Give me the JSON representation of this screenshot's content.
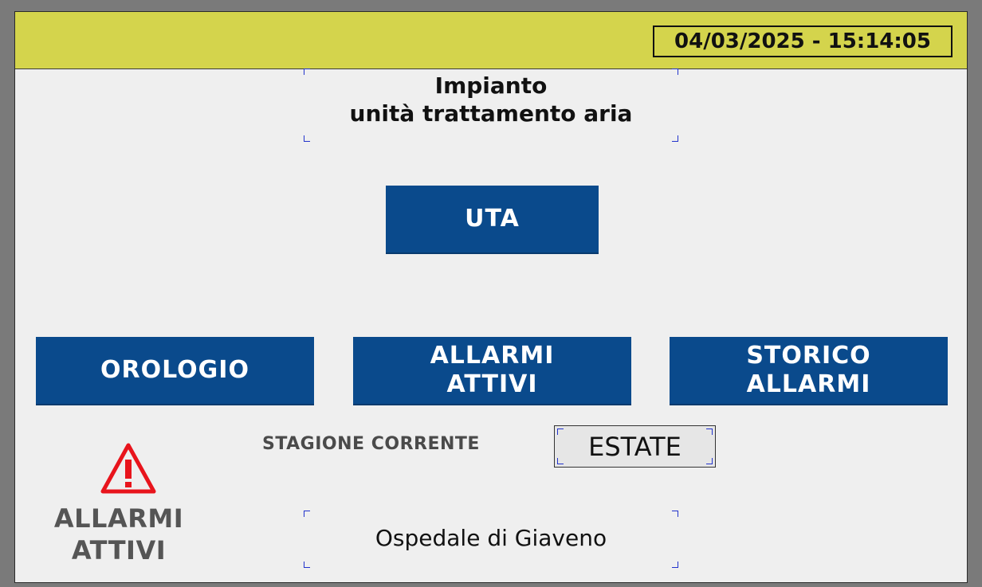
{
  "header": {
    "datetime": "04/03/2025 - 15:14:05",
    "background_color": "#d4d44c"
  },
  "title": {
    "line1": "Impianto",
    "line2": "unità trattamento aria"
  },
  "buttons": {
    "uta": "UTA",
    "orologio": "OROLOGIO",
    "allarmi_attivi": {
      "line1": "ALLARMI",
      "line2": "ATTIVI"
    },
    "storico_allarmi": {
      "line1": "STORICO",
      "line2": "ALLARMI"
    },
    "color": "#0a4a8c"
  },
  "season": {
    "label": "STAGIONE CORRENTE",
    "value": "ESTATE"
  },
  "alarm_indicator": {
    "icon": "warning-triangle-icon",
    "line1": "ALLARMI",
    "line2": "ATTIVI",
    "icon_color": "#e8141c"
  },
  "site": {
    "name": "Ospedale di Giaveno"
  }
}
